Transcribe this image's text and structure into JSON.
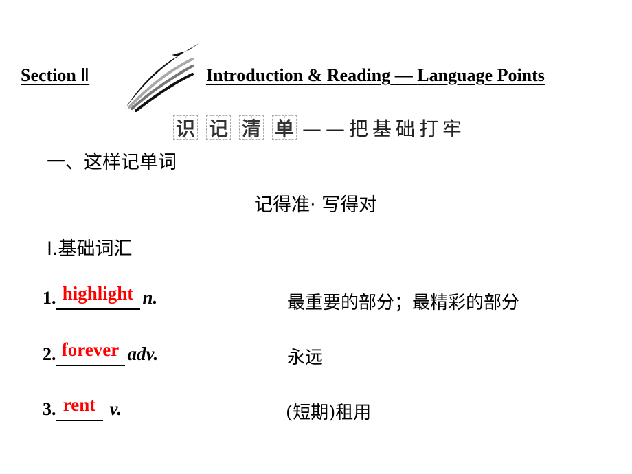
{
  "header": {
    "section_label": "Section",
    "section_numeral": "Ⅱ",
    "title_words": [
      "Introduction",
      "&",
      "Reading",
      "—",
      "Language",
      "Points"
    ]
  },
  "banner": {
    "boxed_chars": [
      "识",
      "记",
      "清",
      "单"
    ],
    "subtitle": "——把基础打牢"
  },
  "part_heading": "一、这样记单词",
  "motto": "记得准·  写得对",
  "subsection_heading": "Ⅰ.基础词汇",
  "vocab_items": [
    {
      "number": "1.",
      "answer": "highlight",
      "pos": "n.",
      "meaning": "最重要的部分；最精彩的部分"
    },
    {
      "number": "2.",
      "answer": "forever",
      "pos": "adv.",
      "meaning": "永远"
    },
    {
      "number": "3.",
      "answer": "rent",
      "pos": "v.",
      "meaning": "(短期)租用"
    }
  ],
  "colors": {
    "answer": "#ff0000",
    "text": "#000000"
  }
}
